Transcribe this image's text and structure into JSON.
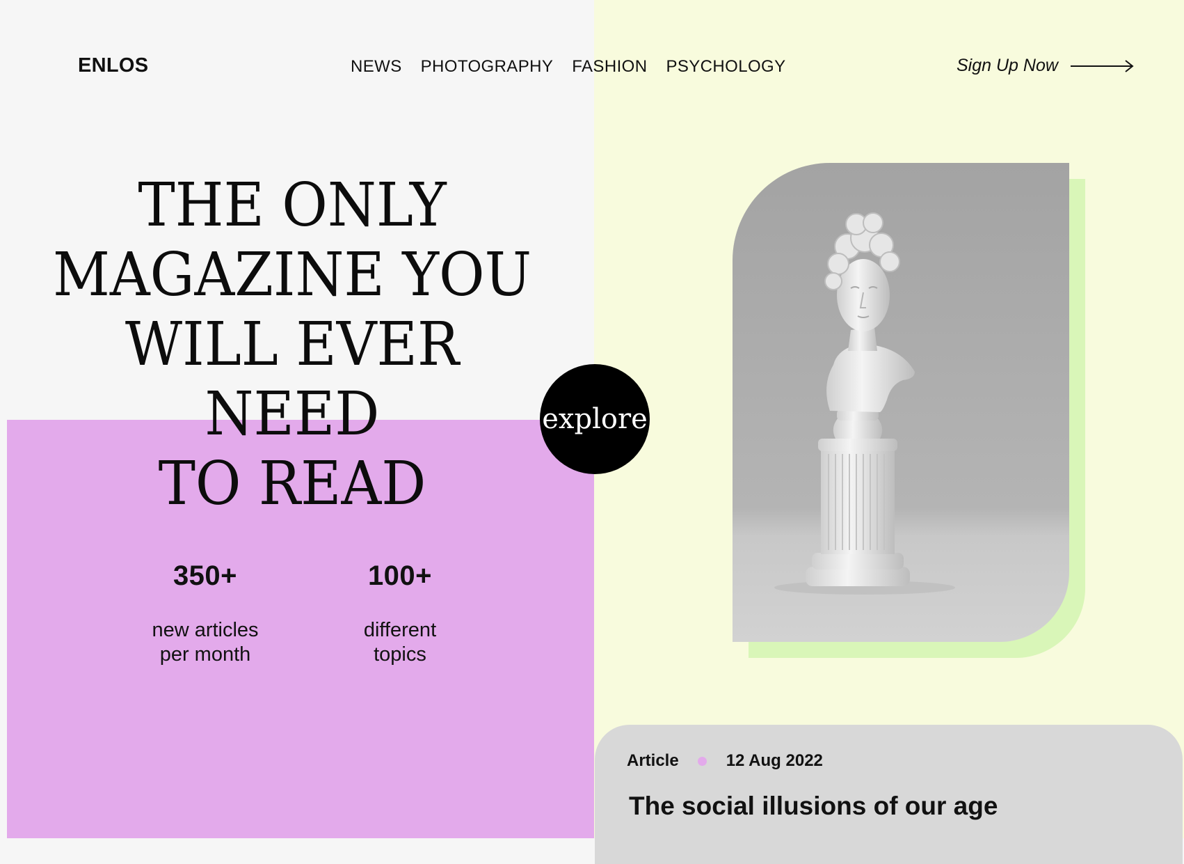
{
  "brand": {
    "logo": "ENLOS"
  },
  "nav": {
    "items": [
      "NEWS",
      "PHOTOGRAPHY",
      "FASHION",
      "PSYCHOLOGY"
    ]
  },
  "cta": {
    "signup_label": "Sign Up Now",
    "icon": "arrow-right-icon"
  },
  "hero": {
    "headline_lines": [
      "THE ONLY",
      "MAGAZINE YOU",
      "WILL EVER NEED",
      "TO READ"
    ],
    "explore_label": "explore"
  },
  "stats": [
    {
      "value": "350+",
      "label_line1": "new articles",
      "label_line2": "per month"
    },
    {
      "value": "100+",
      "label_line1": "different",
      "label_line2": "topics"
    }
  ],
  "article": {
    "type": "Article",
    "date": "12 Aug 2022",
    "title": "The social illusions of our age"
  },
  "colors": {
    "left_bg": "#f6f6f6",
    "purple": "#e3aaeb",
    "right_bg": "#f8fbdd",
    "green_shadow": "#d9f6b8",
    "card_gray": "#d8d8d8",
    "black": "#000000"
  }
}
